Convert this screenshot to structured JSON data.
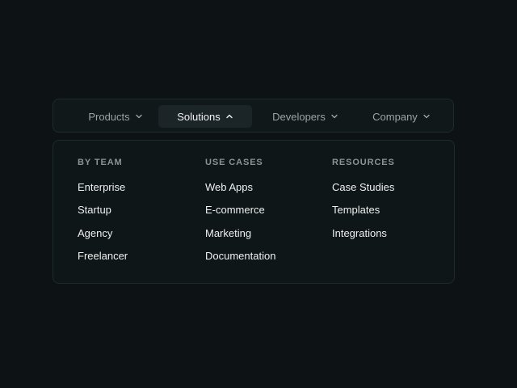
{
  "nav": {
    "items": [
      {
        "label": "Products",
        "active": false,
        "chevron": "chevron-down-icon"
      },
      {
        "label": "Solutions",
        "active": true,
        "chevron": "chevron-up-icon"
      },
      {
        "label": "Developers",
        "active": false,
        "chevron": "chevron-down-icon"
      },
      {
        "label": "Company",
        "active": false,
        "chevron": "chevron-down-icon"
      }
    ]
  },
  "dropdown": {
    "columns": [
      {
        "heading": "BY TEAM",
        "links": [
          "Enterprise",
          "Startup",
          "Agency",
          "Freelancer"
        ]
      },
      {
        "heading": "USE CASES",
        "links": [
          "Web Apps",
          "E-commerce",
          "Marketing",
          "Documentation"
        ]
      },
      {
        "heading": "RESOURCES",
        "links": [
          "Case Studies",
          "Templates",
          "Integrations"
        ]
      }
    ]
  },
  "colors": {
    "background": "#0d1214",
    "surface": "#111819",
    "active_tab": "#1b2527",
    "border": "#1f2a2c",
    "text_primary": "#eef1f2",
    "text_muted": "#9aa3a6"
  }
}
